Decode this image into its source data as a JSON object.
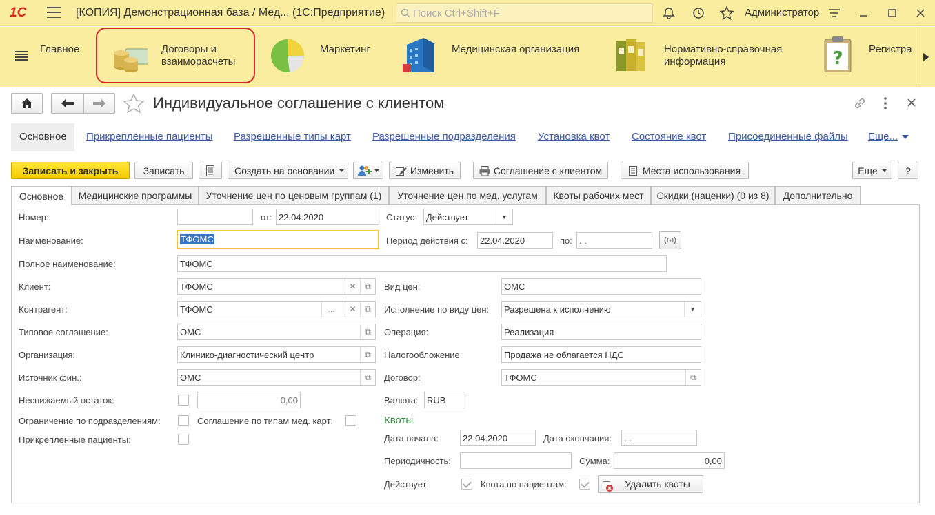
{
  "app": {
    "logo": "1С",
    "window_title": "[КОПИЯ] Демонстрационная база / Мед...   (1С:Предприятие)",
    "search_placeholder": "Поиск Ctrl+Shift+F",
    "user": "Администратор"
  },
  "sections": [
    {
      "label": "Главное"
    },
    {
      "label": "Договоры и взаиморасчеты"
    },
    {
      "label": "Маркетинг"
    },
    {
      "label": "Медицинская организация"
    },
    {
      "label": "Нормативно-справочная информация"
    },
    {
      "label": "Регистра"
    }
  ],
  "form": {
    "title": "Индивидуальное соглашение с клиентом",
    "nav_links": [
      "Основное",
      "Прикрепленные пациенты",
      "Разрешенные типы карт",
      "Разрешенные подразделения",
      "Установка квот",
      "Состояние квот",
      "Присоединенные файлы",
      "Еще..."
    ],
    "toolbar": {
      "save_close": "Записать и закрыть",
      "save": "Записать",
      "create_based": "Создать на основании",
      "edit": "Изменить",
      "agreement": "Соглашение с клиентом",
      "usage": "Места использования",
      "more": "Еще",
      "help": "?"
    },
    "tabs": [
      "Основное",
      "Медицинские программы",
      "Уточнение цен по ценовым группам (1)",
      "Уточнение цен по мед. услугам",
      "Квоты рабочих мест",
      "Скидки (наценки) (0 из 8)",
      "Дополнительно"
    ],
    "labels": {
      "number": "Номер:",
      "from": "от:",
      "status": "Статус:",
      "name": "Наименование:",
      "period_from": "Период действия с:",
      "period_to": "по:",
      "full_name": "Полное наименование:",
      "client": "Клиент:",
      "price_type": "Вид цен:",
      "counterparty": "Контрагент:",
      "execution": "Исполнение по виду цен:",
      "typical": "Типовое соглашение:",
      "operation": "Операция:",
      "organization": "Организация:",
      "taxation": "Налогообложение:",
      "fin_source": "Источник фин.:",
      "contract": "Договор:",
      "min_balance": "Неснижаемый остаток:",
      "currency": "Валюта:",
      "dept_limit": "Ограничение по подразделениям:",
      "card_types": "Соглашение по типам мед. карт:",
      "attached": "Прикрепленные пациенты:",
      "quotas": "Квоты",
      "start_date": "Дата начала:",
      "end_date": "Дата окончания:",
      "periodicity": "Периодичность:",
      "sum": "Сумма:",
      "active": "Действует:",
      "patient_quota": "Квота по пациентам:",
      "delete_quotas": "Удалить квоты"
    },
    "values": {
      "number": "",
      "date": "22.04.2020",
      "status": "Действует",
      "name": "ТФОМС",
      "period_from": "22.04.2020",
      "period_to": ". .",
      "full_name": "ТФОМС",
      "client": "ТФОМС",
      "price_type": "ОМС",
      "counterparty": "ТФОМС",
      "execution": "Разрешена к исполнению",
      "typical": "ОМС",
      "operation": "Реализация",
      "organization": "Клинико-диагностический центр",
      "taxation": "Продажа не облагается НДС",
      "fin_source": "ОМС",
      "contract": "ТФОМС",
      "min_balance": "0,00",
      "currency": "RUB",
      "start_date": "22.04.2020",
      "end_date": ". .",
      "periodicity": "",
      "sum": "0,00"
    }
  },
  "colors": {
    "accent_yellow": "#fbeda0",
    "highlight_red": "#d6242c",
    "link_blue": "#3a5aa5",
    "quota_green": "#2e8b3c"
  }
}
